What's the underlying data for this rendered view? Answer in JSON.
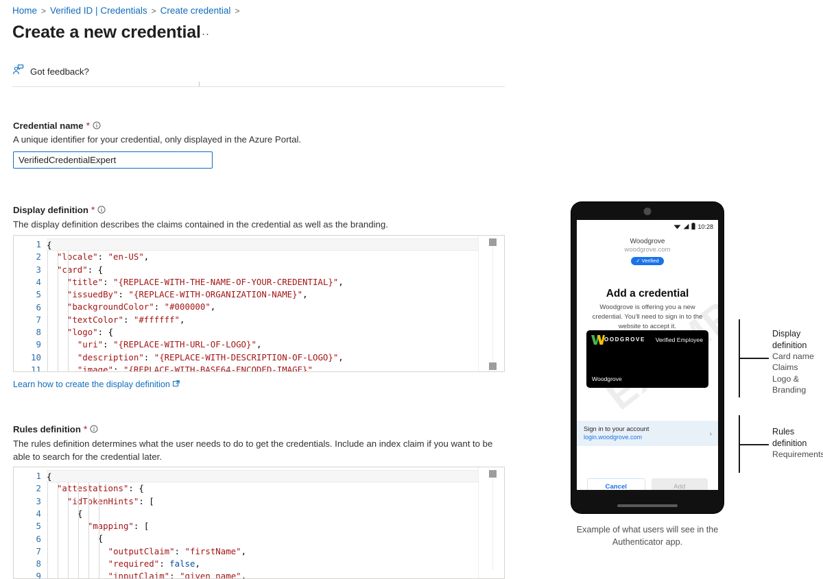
{
  "breadcrumb": {
    "items": [
      "Home",
      "Verified ID | Credentials",
      "Create credential"
    ],
    "separator": ">"
  },
  "header": {
    "title": "Create a new credential",
    "ellipsis": "···"
  },
  "feedback": {
    "label": "Got feedback?",
    "icon": "feedback-person-icon"
  },
  "credential_name": {
    "label": "Credential name",
    "required_mark": "*",
    "description": "A unique identifier for your credential, only displayed in the Azure Portal.",
    "value": "VerifiedCredentialExpert",
    "placeholder": ""
  },
  "display_definition": {
    "label": "Display definition",
    "required_mark": "*",
    "description": "The display definition describes the claims contained in the credential as well as the branding.",
    "link": "Learn how to create the display definition",
    "link_icon": "external-link-icon",
    "lines": [
      {
        "n": 1,
        "text": "{"
      },
      {
        "n": 2,
        "text": "  \"locale\": \"en-US\","
      },
      {
        "n": 3,
        "text": "  \"card\": {"
      },
      {
        "n": 4,
        "text": "    \"title\": \"{REPLACE-WITH-THE-NAME-OF-YOUR-CREDENTIAL}\","
      },
      {
        "n": 5,
        "text": "    \"issuedBy\": \"{REPLACE-WITH-ORGANIZATION-NAME}\","
      },
      {
        "n": 6,
        "text": "    \"backgroundColor\": \"#000000\","
      },
      {
        "n": 7,
        "text": "    \"textColor\": \"#ffffff\","
      },
      {
        "n": 8,
        "text": "    \"logo\": {"
      },
      {
        "n": 9,
        "text": "      \"uri\": \"{REPLACE-WITH-URL-OF-LOGO}\","
      },
      {
        "n": 10,
        "text": "      \"description\": \"{REPLACE-WITH-DESCRIPTION-OF-LOGO}\","
      },
      {
        "n": 11,
        "text": "      \"image\": \"{REPLACE-WITH-BASE64-ENCODED-IMAGE}\""
      }
    ]
  },
  "rules_definition": {
    "label": "Rules definition",
    "required_mark": "*",
    "description": "The rules definition determines what the user needs to do to get the credentials. Include an index claim if you want to be able to search for the credential later.",
    "lines": [
      {
        "n": 1,
        "text": "{"
      },
      {
        "n": 2,
        "text": "  \"attestations\": {"
      },
      {
        "n": 3,
        "text": "    \"idTokenHints\": ["
      },
      {
        "n": 4,
        "text": "      {"
      },
      {
        "n": 5,
        "text": "        \"mapping\": ["
      },
      {
        "n": 6,
        "text": "          {"
      },
      {
        "n": 7,
        "text": "            \"outputClaim\": \"firstName\","
      },
      {
        "n": 8,
        "text": "            \"required\": false,"
      },
      {
        "n": 9,
        "text": "            \"inputClaim\": \"given_name\","
      }
    ]
  },
  "phone": {
    "status": {
      "time": "10:28",
      "icons": [
        "wifi-icon",
        "signal-icon",
        "battery-icon"
      ]
    },
    "org_name": "Woodgrove",
    "org_domain": "woodgrove.com",
    "verified_badge": "Verified",
    "verified_check": "✓",
    "title": "Add a credential",
    "subtitle": "Woodgrove is offering you a new credential. You'll need to sign in to the website to accept it.",
    "card": {
      "logo_text": "OODGROVE",
      "credential_type": "Verified Employee",
      "issuer": "Woodgrove",
      "background_color": "#000000",
      "text_color": "#ffffff"
    },
    "signin": {
      "title": "Sign in to your account",
      "url": "login.woodgrove.com",
      "chevron": "›"
    },
    "buttons": {
      "cancel": "Cancel",
      "add": "Add"
    },
    "watermark": "EXAMPLE",
    "caption": "Example of what users will see in the Authenticator app."
  },
  "annotations": [
    {
      "heading": "Display definition",
      "items": [
        "Card name",
        "Claims",
        "Logo & Branding"
      ]
    },
    {
      "heading": "Rules definition",
      "items": [
        "Requirements"
      ]
    }
  ],
  "colors": {
    "link": "#0f6cbd",
    "required": "#a4262c",
    "badge_blue": "#1a73e8",
    "card_bg": "#000000"
  }
}
